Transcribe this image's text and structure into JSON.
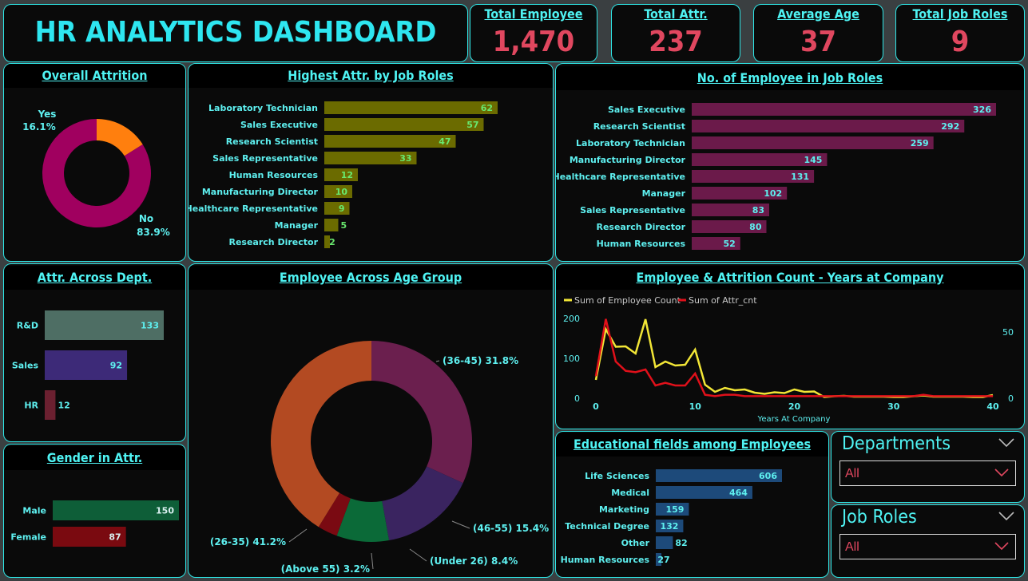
{
  "header": {
    "title": "HR ANALYTICS DASHBOARD"
  },
  "kpis": [
    {
      "label": "Total Employee",
      "value": "1,470"
    },
    {
      "label": "Total Attr.",
      "value": "237"
    },
    {
      "label": "Average Age",
      "value": "37"
    },
    {
      "label": "Total Job Roles",
      "value": "9"
    }
  ],
  "overall_attrition": {
    "title": "Overall Attrition",
    "slices": [
      {
        "label": "Yes",
        "pct_label": "16.1%",
        "value": 16.1,
        "color": "#ff7f0e"
      },
      {
        "label": "No",
        "pct_label": "83.9%",
        "value": 83.9,
        "color": "#a0005f"
      }
    ]
  },
  "attr_by_role": {
    "title": "Highest Attr. by Job Roles",
    "color": "#6b6b00",
    "label_color": "#69e86e",
    "rows": [
      {
        "label": "Laboratory Technician",
        "value": 62
      },
      {
        "label": "Sales Executive",
        "value": 57
      },
      {
        "label": "Research Scientist",
        "value": 47
      },
      {
        "label": "Sales Representative",
        "value": 33
      },
      {
        "label": "Human Resources",
        "value": 12
      },
      {
        "label": "Manufacturing Director",
        "value": 10
      },
      {
        "label": "Healthcare Representative",
        "value": 9
      },
      {
        "label": "Manager",
        "value": 5
      },
      {
        "label": "Research Director",
        "value": 2
      }
    ]
  },
  "emp_by_role": {
    "title": "No. of Employee in Job Roles",
    "color": "#6b1a4a",
    "label_color": "#5ef0f0",
    "rows": [
      {
        "label": "Sales Executive",
        "value": 326
      },
      {
        "label": "Research Scientist",
        "value": 292
      },
      {
        "label": "Laboratory Technician",
        "value": 259
      },
      {
        "label": "Manufacturing Director",
        "value": 145
      },
      {
        "label": "Healthcare Representative",
        "value": 131
      },
      {
        "label": "Manager",
        "value": 102
      },
      {
        "label": "Sales Representative",
        "value": 83
      },
      {
        "label": "Research Director",
        "value": 80
      },
      {
        "label": "Human Resources",
        "value": 52
      }
    ]
  },
  "attr_dept": {
    "title": "Attr. Across Dept.",
    "rows": [
      {
        "label": "R&D",
        "value": 133,
        "color": "#4e6e64"
      },
      {
        "label": "Sales",
        "value": 92,
        "color": "#3d2a78"
      },
      {
        "label": "HR",
        "value": 12,
        "color": "#6b2030"
      }
    ]
  },
  "gender": {
    "title": "Gender in Attr.",
    "rows": [
      {
        "label": "Male",
        "value": 150,
        "color": "#0e5e38"
      },
      {
        "label": "Female",
        "value": 87,
        "color": "#7a0a10"
      }
    ]
  },
  "age_group": {
    "title": "Employee Across Age Group",
    "slices": [
      {
        "label": "(36-45) 31.8%",
        "value": 31.8,
        "color": "#6b1f4e"
      },
      {
        "label": "(46-55) 15.4%",
        "value": 15.4,
        "color": "#3a2460"
      },
      {
        "label": "(Under 26) 8.4%",
        "value": 8.4,
        "color": "#0b6a38"
      },
      {
        "label": "(Above 55) 3.2%",
        "value": 3.2,
        "color": "#7a0a12"
      },
      {
        "label": "(26-35) 41.2%",
        "value": 41.2,
        "color": "#b34a22"
      }
    ]
  },
  "years_chart": {
    "title": "Employee & Attrition Count - Years at Company",
    "legend": [
      {
        "name": "Sum of Employee Count",
        "color": "#f2e636"
      },
      {
        "name": "Sum of Attr_cnt",
        "color": "#e0101a"
      }
    ],
    "xlabel": "Years At Company",
    "x_ticks": [
      "0",
      "10",
      "20",
      "30",
      "40"
    ],
    "y_left_ticks": [
      "200",
      "100",
      "0"
    ],
    "y_right_ticks": [
      "50",
      "0"
    ]
  },
  "chart_data": {
    "type": "line",
    "title": "Employee & Attrition Count - Years at Company",
    "xlabel": "Years At Company",
    "xlim": [
      0,
      40
    ],
    "ylim_left": [
      0,
      200
    ],
    "ylim_right": [
      0,
      60
    ],
    "x": [
      0,
      1,
      2,
      3,
      4,
      5,
      6,
      7,
      8,
      9,
      10,
      11,
      12,
      13,
      14,
      15,
      16,
      17,
      18,
      19,
      20,
      21,
      22,
      23,
      24,
      25,
      26,
      27,
      28,
      29,
      30,
      31,
      32,
      33,
      34,
      35,
      36,
      37,
      38,
      39,
      40
    ],
    "series": [
      {
        "name": "Sum of Employee Count",
        "axis": "left",
        "values": [
          44,
          171,
          127,
          128,
          110,
          196,
          76,
          90,
          80,
          82,
          120,
          32,
          14,
          24,
          18,
          20,
          12,
          9,
          13,
          11,
          20,
          14,
          15,
          1,
          3,
          4,
          2,
          2,
          2,
          2,
          1,
          1,
          3,
          5,
          2,
          2,
          2,
          2,
          1,
          1,
          6
        ]
      },
      {
        "name": "Sum of Attr_cnt",
        "axis": "right",
        "values": [
          16,
          59,
          27,
          20,
          19,
          21,
          9,
          11,
          9,
          9,
          18,
          2,
          1,
          2,
          2,
          1,
          1,
          1,
          1,
          1,
          1,
          1,
          1,
          1,
          1,
          1,
          1,
          1,
          1,
          1,
          1,
          1,
          1,
          2,
          1,
          1,
          1,
          1,
          1,
          1,
          1
        ]
      }
    ]
  },
  "education": {
    "title": "Educational fields among Employees",
    "color": "#1d4a7a",
    "rows": [
      {
        "label": "Life Sciences",
        "value": 606
      },
      {
        "label": "Medical",
        "value": 464
      },
      {
        "label": "Marketing",
        "value": 159
      },
      {
        "label": "Technical Degree",
        "value": 132
      },
      {
        "label": "Other",
        "value": 82
      },
      {
        "label": "Human Resources",
        "value": 27
      }
    ]
  },
  "slicers": [
    {
      "title": "Departments",
      "value": "All"
    },
    {
      "title": "Job Roles",
      "value": "All"
    }
  ]
}
